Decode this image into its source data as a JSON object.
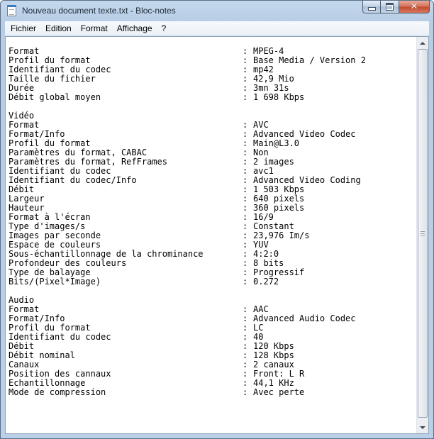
{
  "window": {
    "title": "Nouveau document texte.txt - Bloc-notes",
    "close_glyph": "✕"
  },
  "menu": [
    {
      "label": "Fichier"
    },
    {
      "label": "Edition"
    },
    {
      "label": "Format"
    },
    {
      "label": "Affichage"
    },
    {
      "label": "?"
    }
  ],
  "document": {
    "general": [
      {
        "key": "Format",
        "value": "MPEG-4"
      },
      {
        "key": "Profil du format",
        "value": "Base Media / Version 2"
      },
      {
        "key": "Identifiant du codec",
        "value": "mp42"
      },
      {
        "key": "Taille du fichier",
        "value": "42,9 Mio"
      },
      {
        "key": "Durée",
        "value": "3mn 31s"
      },
      {
        "key": "Débit global moyen",
        "value": "1 698 Kbps"
      }
    ],
    "video_title": "Vidéo",
    "video": [
      {
        "key": "Format",
        "value": "AVC"
      },
      {
        "key": "Format/Info",
        "value": "Advanced Video Codec"
      },
      {
        "key": "Profil du format",
        "value": "Main@L3.0"
      },
      {
        "key": "Paramètres du format, CABAC",
        "value": "Non"
      },
      {
        "key": "Paramètres du format, RefFrames",
        "value": "2 images"
      },
      {
        "key": "Identifiant du codec",
        "value": "avc1"
      },
      {
        "key": "Identifiant du codec/Info",
        "value": "Advanced Video Coding"
      },
      {
        "key": "Débit",
        "value": "1 503 Kbps"
      },
      {
        "key": "Largeur",
        "value": "640 pixels"
      },
      {
        "key": "Hauteur",
        "value": "360 pixels"
      },
      {
        "key": "Format à l'écran",
        "value": "16/9"
      },
      {
        "key": "Type d'images/s",
        "value": "Constant"
      },
      {
        "key": "Images par seconde",
        "value": "23,976 Im/s"
      },
      {
        "key": "Espace de couleurs",
        "value": "YUV"
      },
      {
        "key": "Sous-échantillonnage de la chrominance",
        "value": "4:2:0"
      },
      {
        "key": "Profondeur des couleurs",
        "value": "8 bits"
      },
      {
        "key": "Type de balayage",
        "value": "Progressif"
      },
      {
        "key": "Bits/(Pixel*Image)",
        "value": "0.272"
      }
    ],
    "audio_title": "Audio",
    "audio": [
      {
        "key": "Format",
        "value": "AAC"
      },
      {
        "key": "Format/Info",
        "value": "Advanced Audio Codec"
      },
      {
        "key": "Profil du format",
        "value": "LC"
      },
      {
        "key": "Identifiant du codec",
        "value": "40"
      },
      {
        "key": "Débit",
        "value": "120 Kbps"
      },
      {
        "key": "Débit nominal",
        "value": "128 Kbps"
      },
      {
        "key": "Canaux",
        "value": "2 canaux"
      },
      {
        "key": "Position des cannaux",
        "value": "Front: L R"
      },
      {
        "key": "Echantillonnage",
        "value": "44,1 KHz"
      },
      {
        "key": "Mode de compression",
        "value": "Avec perte"
      }
    ]
  }
}
